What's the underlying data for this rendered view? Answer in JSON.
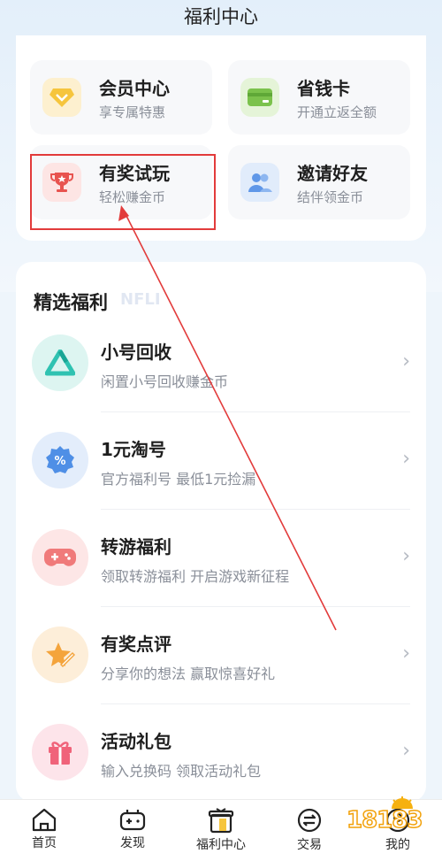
{
  "header": {
    "title": "福利中心"
  },
  "top_tiles": [
    {
      "title": "会员中心",
      "subtitle": "享专属特惠",
      "icon": "diamond-badge-icon",
      "color": "#f6c53d"
    },
    {
      "title": "省钱卡",
      "subtitle": "开通立返全额",
      "icon": "card-icon",
      "color": "#7bc24c"
    },
    {
      "title": "有奖试玩",
      "subtitle": "轻松赚金币",
      "icon": "trophy-icon",
      "color": "#e8534f"
    },
    {
      "title": "邀请好友",
      "subtitle": "结伴领金币",
      "icon": "friends-icon",
      "color": "#5f97e8"
    }
  ],
  "section": {
    "title": "精选福利",
    "items": [
      {
        "title": "小号回收",
        "subtitle": "闲置小号回收赚金币",
        "icon": "recycle-triangle-icon",
        "color": "#2fc2b1"
      },
      {
        "title": "1元淘号",
        "subtitle": "官方福利号 最低1元捡漏",
        "icon": "percent-badge-icon",
        "color": "#4f8fe6"
      },
      {
        "title": "转游福利",
        "subtitle": "领取转游福利 开启游戏新征程",
        "icon": "gamepad-icon",
        "color": "#f07a7a"
      },
      {
        "title": "有奖点评",
        "subtitle": "分享你的想法 赢取惊喜好礼",
        "icon": "star-pen-icon",
        "color": "#f4a43c"
      },
      {
        "title": "活动礼包",
        "subtitle": "输入兑换码 领取活动礼包",
        "icon": "gift-icon",
        "color": "#f0637a"
      }
    ]
  },
  "tabbar": [
    {
      "label": "首页",
      "icon": "home-icon"
    },
    {
      "label": "发现",
      "icon": "gamepad-outline-icon"
    },
    {
      "label": "福利中心",
      "icon": "gift-box-icon",
      "active": true
    },
    {
      "label": "交易",
      "icon": "exchange-icon"
    },
    {
      "label": "我的",
      "icon": "user-icon"
    }
  ],
  "watermark": "18183"
}
